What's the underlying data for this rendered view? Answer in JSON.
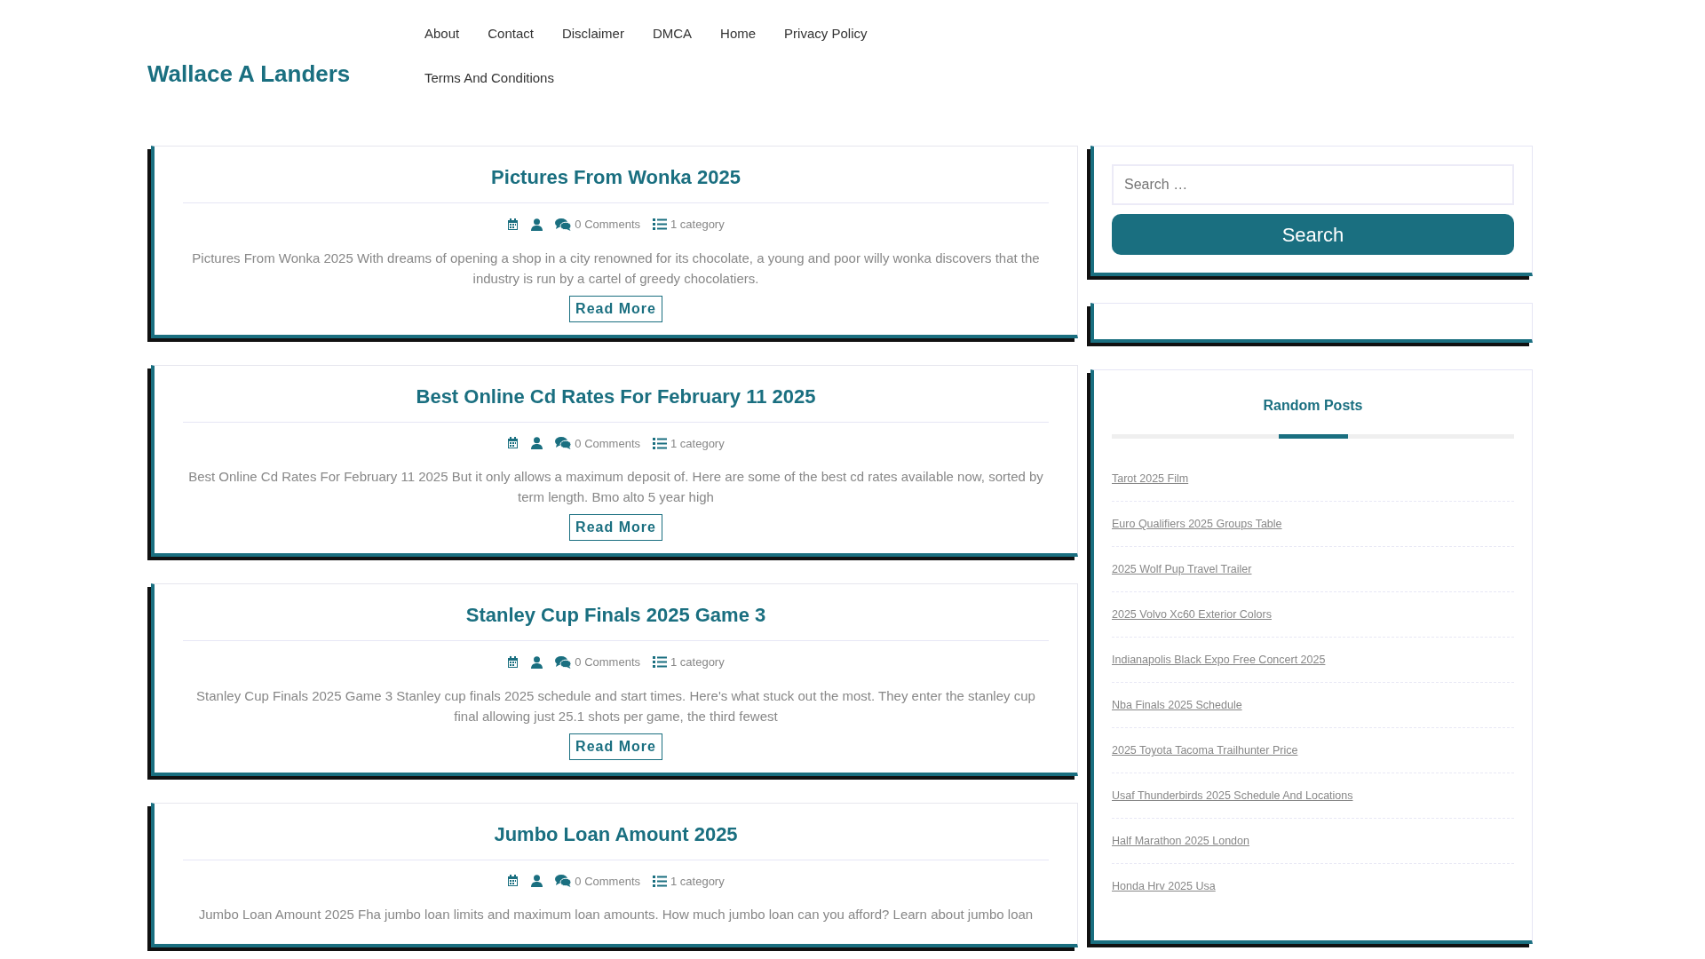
{
  "site_title": "Wallace A Landers",
  "nav": [
    "About",
    "Contact",
    "Disclaimer",
    "DMCA",
    "Home",
    "Privacy Policy",
    "Terms And Conditions"
  ],
  "posts": [
    {
      "title": "Pictures From Wonka 2025",
      "comments": "0 Comments",
      "category": "1 category",
      "excerpt": "Pictures From Wonka 2025 With dreams of opening a shop in a city renowned for its chocolate, a young and poor willy wonka discovers that the industry is run by a cartel of greedy chocolatiers.",
      "read_more": "Read More"
    },
    {
      "title": "Best Online Cd Rates For February 11 2025",
      "comments": "0 Comments",
      "category": "1 category",
      "excerpt": "Best Online Cd Rates For February 11 2025 But it only allows a maximum deposit of. Here are some of the best cd rates available now, sorted by term length. Bmo alto 5 year high",
      "read_more": "Read More"
    },
    {
      "title": "Stanley Cup Finals 2025 Game 3",
      "comments": "0 Comments",
      "category": "1 category",
      "excerpt": "Stanley Cup Finals 2025 Game 3 Stanley cup finals 2025 schedule and start times. Here's what stuck out the most. They enter the stanley cup final allowing just 25.1 shots per game, the third fewest",
      "read_more": "Read More"
    },
    {
      "title": "Jumbo Loan Amount 2025",
      "comments": "0 Comments",
      "category": "1 category",
      "excerpt": "Jumbo Loan Amount 2025 Fha jumbo loan limits and maximum loan amounts. How much jumbo loan can you afford? Learn about jumbo loan"
    }
  ],
  "sidebar": {
    "search": {
      "placeholder": "Search …",
      "button": "Search"
    },
    "random_posts": {
      "title": "Random Posts",
      "items": [
        "Tarot 2025 Film",
        "Euro Qualifiers 2025 Groups Table",
        "2025 Wolf Pup Travel Trailer",
        "2025 Volvo Xc60 Exterior Colors",
        "Indianapolis Black Expo Free Concert 2025",
        "Nba Finals 2025 Schedule",
        "2025 Toyota Tacoma Trailhunter Price",
        "Usaf Thunderbirds 2025 Schedule And Locations",
        "Half Marathon 2025 London",
        "Honda Hrv 2025 Usa"
      ]
    }
  }
}
